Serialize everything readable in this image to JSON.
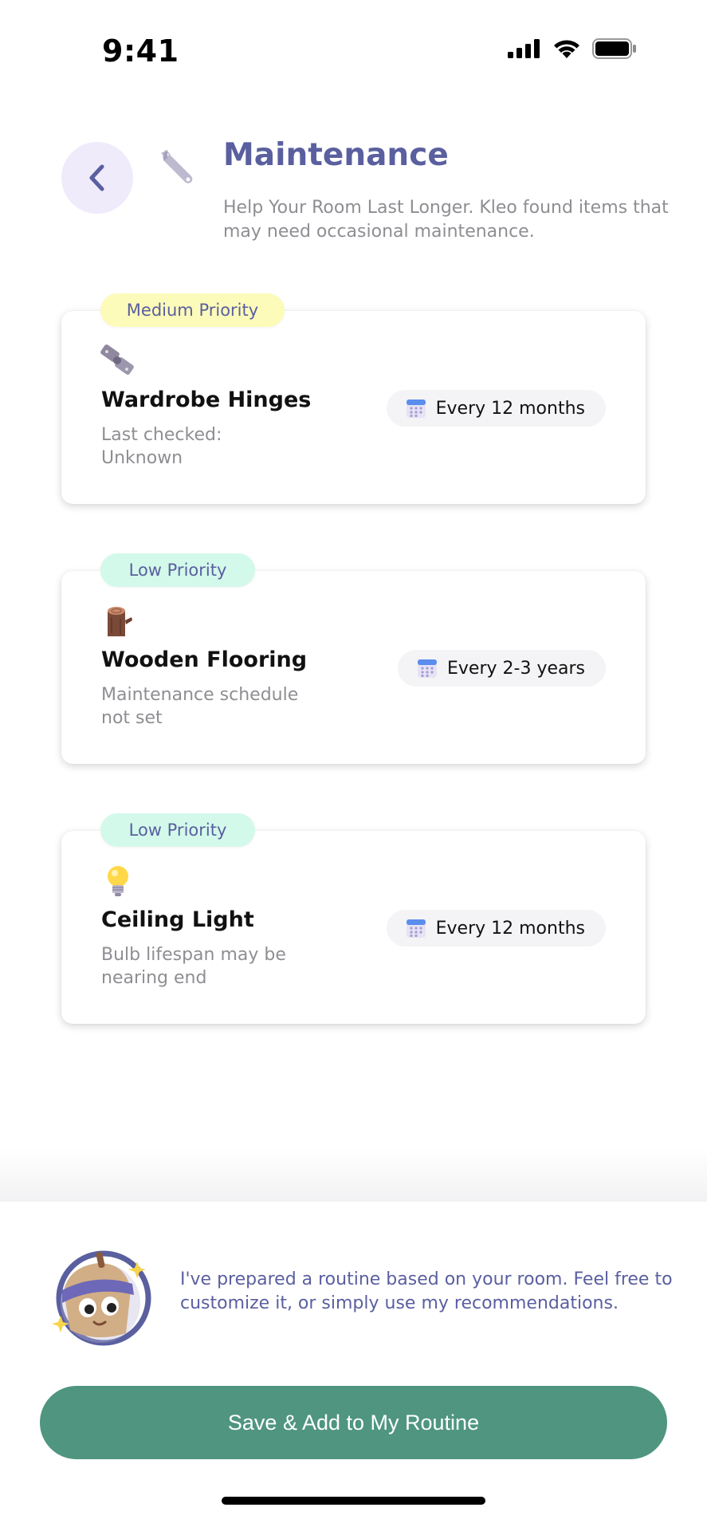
{
  "status_bar": {
    "time": "9:41"
  },
  "header": {
    "title": "Maintenance",
    "subtitle": "Help Your Room Last Longer. Kleo found items that may need occasional maintenance.",
    "icon": "wrench-icon"
  },
  "items": [
    {
      "priority": "Medium Priority",
      "priority_color": "#FDFBB9",
      "icon": "hinge-icon",
      "name": "Wardrobe Hinges",
      "description": "Last checked: Unknown",
      "schedule": "Every 12 months"
    },
    {
      "priority": "Low Priority",
      "priority_color": "#D3F9EA",
      "icon": "wood-log-icon",
      "name": "Wooden Flooring",
      "description": "Maintenance schedule not set",
      "schedule": "Every 2-3 years"
    },
    {
      "priority": "Low Priority",
      "priority_color": "#D3F9EA",
      "icon": "light-bulb-icon",
      "name": "Ceiling Light",
      "description": "Bulb lifespan may be nearing end",
      "schedule": "Every 12 months"
    }
  ],
  "mascot": {
    "message": "I've prepared a routine based on your room. Feel free to customize it, or simply use my recommendations."
  },
  "actions": {
    "save_label": "Save & Add to My Routine"
  },
  "colors": {
    "accent": "#5A5F9F",
    "primary_button": "#4F9580",
    "back_button_bg": "#EFEBFB"
  }
}
